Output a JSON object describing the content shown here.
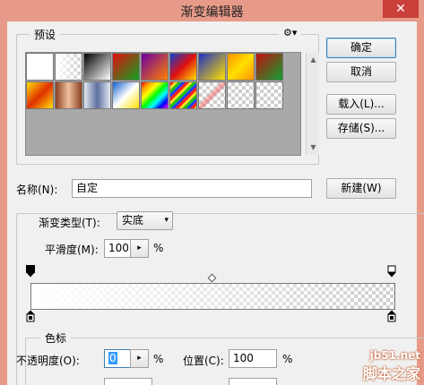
{
  "window": {
    "title": "渐变编辑器",
    "close_glyph": "✕"
  },
  "presets": {
    "legend": "预设",
    "gear_glyph": "⚙",
    "swatches": [
      {
        "bg": "linear-gradient(to right, #ffffff, #ffffff)"
      },
      {
        "bg": "linear-gradient(to right, #ffffff, rgba(255,255,255,0))",
        "checker": true
      },
      {
        "bg": "linear-gradient(135deg, #000000, #ffffff)"
      },
      {
        "bg": "linear-gradient(135deg, #e01010, #10a020)"
      },
      {
        "bg": "linear-gradient(135deg, #6a00a0, #ff8000)"
      },
      {
        "bg": "linear-gradient(135deg, #1040d0, #e01010, #ffe000)"
      },
      {
        "bg": "linear-gradient(135deg, #2030c0, #ffe000)"
      },
      {
        "bg": "linear-gradient(135deg, #ff9000, #ffe000, #ff9000)"
      },
      {
        "bg": "linear-gradient(135deg, #c01010, #10a030)"
      },
      {
        "bg": "linear-gradient(135deg, #ffe000, #e03000, #ffe000)"
      },
      {
        "bg": "linear-gradient(to right, #8a4020, #f0c0a0, #8a4020)"
      },
      {
        "bg": "linear-gradient(to right, #e0e8f0, #6070a0, #e0e8f0)"
      },
      {
        "bg": "linear-gradient(135deg, #1060d0, #ffffff, #ffe000)"
      },
      {
        "bg": "linear-gradient(135deg, red, orange, yellow, lime, cyan, blue, magenta)"
      },
      {
        "bg": "repeating-linear-gradient(135deg, #ff2020 0 3px, #ffe020 3px 6px, #20c020 6px 9px, #2040ff 9px 12px)"
      },
      {
        "bg": "linear-gradient(135deg, transparent 40%, rgba(255,0,0,0.4) 50%, transparent 60%)",
        "checker": true
      },
      {
        "bg": "linear-gradient(to right, transparent, transparent)",
        "checker": true
      },
      {
        "bg": "linear-gradient(to right, transparent, transparent)",
        "checker": true
      }
    ]
  },
  "buttons": {
    "ok": "确定",
    "cancel": "取消",
    "load": "载入(L)...",
    "save": "存储(S)...",
    "new": "新建(W)"
  },
  "name": {
    "label": "名称(N):",
    "value": "自定"
  },
  "gradient_type": {
    "label": "渐变类型(T):",
    "value": "实底",
    "arrow": "▾"
  },
  "smoothness": {
    "label": "平滑度(M):",
    "value": "100",
    "unit": "%",
    "stepper": "▸"
  },
  "color_stops": {
    "legend": "色标",
    "opacity_label": "不透明度(O):",
    "opacity_value": "0",
    "opacity_unit": "%",
    "location_label": "位置(C):",
    "location_value": "100",
    "location_unit": "%",
    "stepper": "▸"
  },
  "watermark": {
    "url": "jb51.net",
    "name": "脚本之家"
  }
}
